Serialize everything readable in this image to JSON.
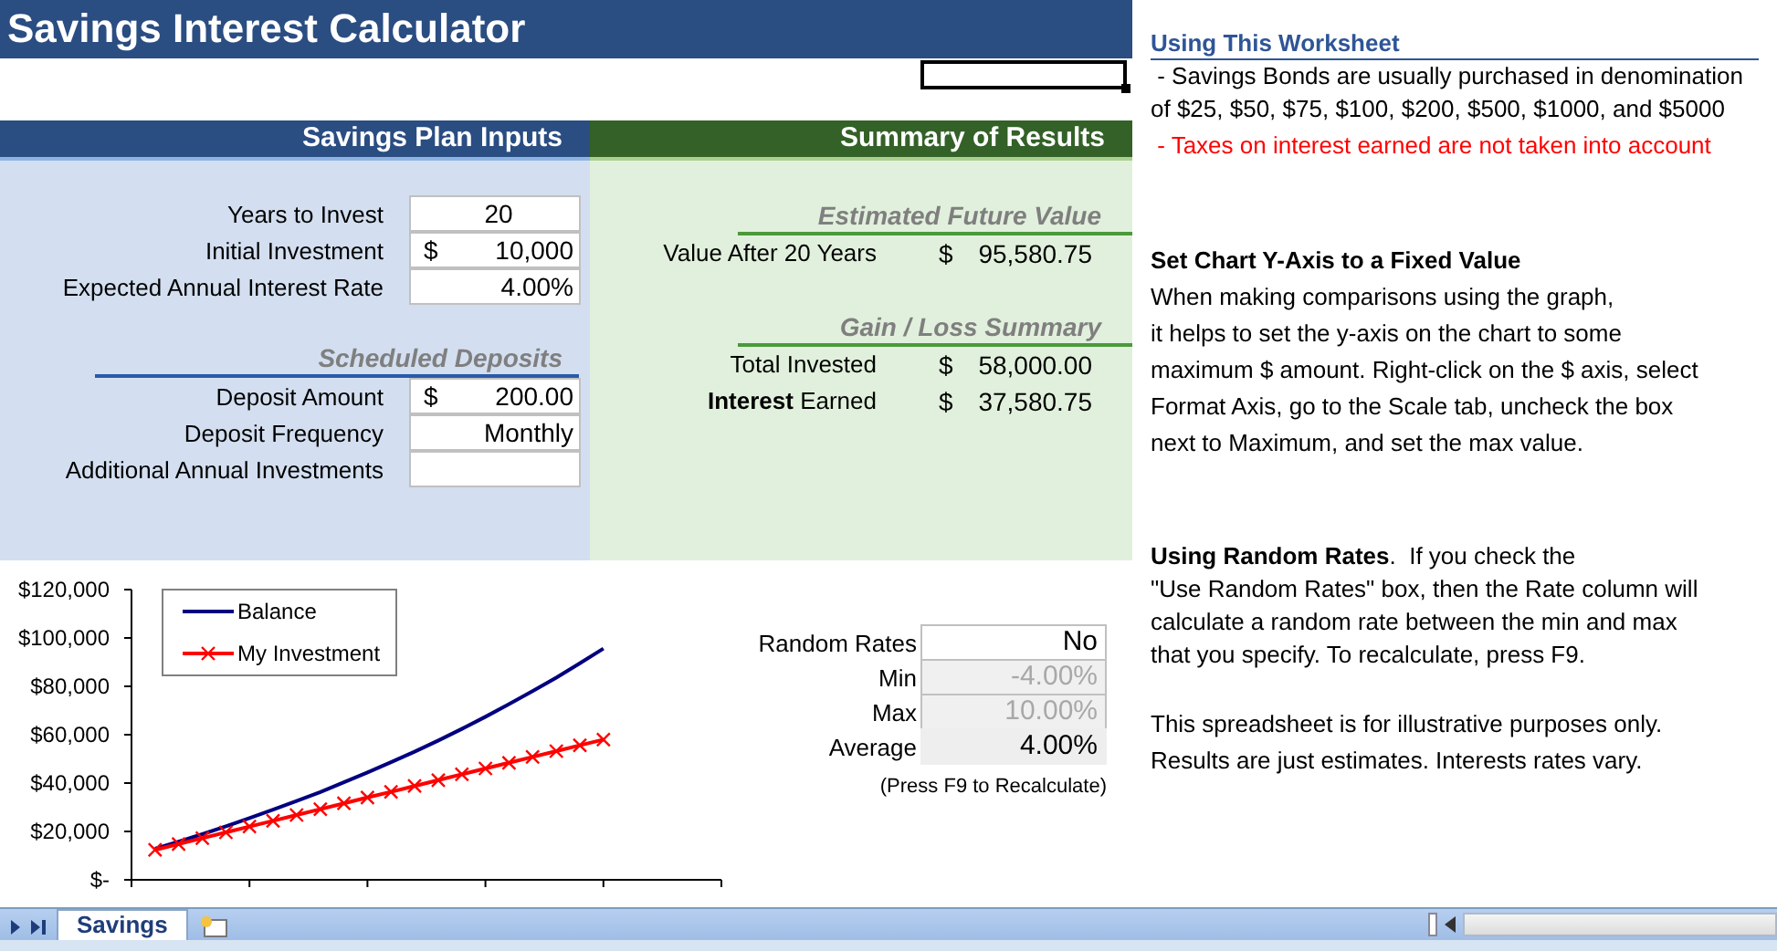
{
  "title": "Savings Interest Calculator",
  "inputs": {
    "header": "Savings Plan Inputs",
    "rows": [
      {
        "label": "Years to Invest",
        "kind": "count",
        "value": "20"
      },
      {
        "label": "Initial Investment",
        "kind": "currency",
        "prefix": "$",
        "value": "10,000"
      },
      {
        "label": "Expected Annual Interest Rate",
        "kind": "percent",
        "value": "4.00%"
      }
    ],
    "deposits": {
      "heading": "Scheduled Deposits",
      "rows": [
        {
          "label": "Deposit Amount",
          "kind": "currency",
          "prefix": "$",
          "value": "200.00"
        },
        {
          "label": "Deposit Frequency",
          "kind": "text",
          "value": "Monthly"
        },
        {
          "label": "Additional Annual Investments",
          "kind": "text"
        }
      ]
    }
  },
  "summary": {
    "header": "Summary of Results",
    "groups": [
      {
        "heading": "Estimated Future Value",
        "rows": [
          {
            "label": "Value After 20 Years",
            "prefix": "$",
            "value": "95,580.75"
          }
        ]
      },
      {
        "heading": "Gain / Loss Summary",
        "rows": [
          {
            "label": "Total Invested",
            "prefix": "$",
            "value": "58,000.00"
          },
          {
            "label": "**Interest** Earned",
            "prefix": "$",
            "value": "37,580.75"
          }
        ]
      }
    ]
  },
  "chart": {
    "chart_data": {
      "type": "line",
      "categories": [
        null,
        null,
        null,
        null,
        null,
        null,
        null,
        null,
        null,
        null,
        null,
        null,
        null,
        null,
        null,
        null,
        null,
        null,
        null,
        null
      ],
      "series": [
        {
          "name": "Balance",
          "color": "#000080",
          "values": [
            12900,
            15800,
            18900,
            22100,
            25500,
            29000,
            32600,
            36300,
            40300,
            44400,
            48600,
            53000,
            57600,
            62400,
            67400,
            72600,
            78000,
            83600,
            89500,
            95600
          ]
        },
        {
          "name": "My Investment",
          "color": "#ff0000",
          "values": [
            12400,
            14800,
            17200,
            19600,
            22000,
            24400,
            26800,
            29200,
            31600,
            34000,
            36400,
            38800,
            41200,
            43600,
            46000,
            48400,
            50800,
            53200,
            55600,
            58000
          ]
        }
      ],
      "legend": true,
      "ylim": [
        0,
        120000
      ],
      "yticks": [
        {
          "value": 0,
          "label": "$-"
        },
        {
          "value": 20000,
          "label": "$20,000"
        },
        {
          "value": 40000,
          "label": "$40,000"
        },
        {
          "value": 60000,
          "label": "$60,000"
        },
        {
          "value": 80000,
          "label": "$80,000"
        },
        {
          "value": 100000,
          "label": "$100,000"
        },
        {
          "value": 120000,
          "label": "$120,000"
        }
      ]
    }
  },
  "random_rates": {
    "rows": [
      {
        "label": "Random Rates",
        "kind": "input",
        "value": "No",
        "disabled": false
      },
      {
        "label": "Min",
        "kind": "input",
        "value": "-4.00%",
        "disabled": true
      },
      {
        "label": "Max",
        "kind": "input",
        "value": "10.00%",
        "disabled": true
      },
      {
        "label": "Average",
        "kind": "result",
        "value": "4.00%"
      }
    ],
    "note": "(Press F9 to Recalculate)"
  },
  "worksheet_notes": {
    "heading": "Using This Worksheet",
    "items": [
      {
        "lines": [
          " - Savings Bonds are usually purchased in denomination",
          "of $25, $50, $75, $100, $200, $500, $1000, and $5000"
        ],
        "color": "#000000"
      },
      {
        "lines": [
          " - Taxes on interest earned are not taken into account"
        ],
        "color": "#ff0000"
      }
    ]
  },
  "tips": [
    {
      "title": "Set Chart Y-Axis to a Fixed Value",
      "lines": [
        "When making comparisons using the graph,",
        "it helps to set the y-axis on the chart to some",
        "maximum $ amount. Right-click on the $ axis, select",
        "Format Axis, go to the Scale tab, uncheck the box",
        "next to Maximum, and set the max value."
      ]
    },
    {
      "lines": [
        "**Using Random Rates**.  If you check the",
        "\"Use Random Rates\" box, then the Rate column will",
        "calculate a random rate between the min and max",
        "that you specify. To recalculate, press F9."
      ]
    },
    {
      "lines": [
        "This spreadsheet is for illustrative purposes only.",
        "Results are just estimates. Interests rates vary."
      ]
    }
  ],
  "sheet_tabs": [
    {
      "label": "Savings",
      "selected": true
    }
  ]
}
